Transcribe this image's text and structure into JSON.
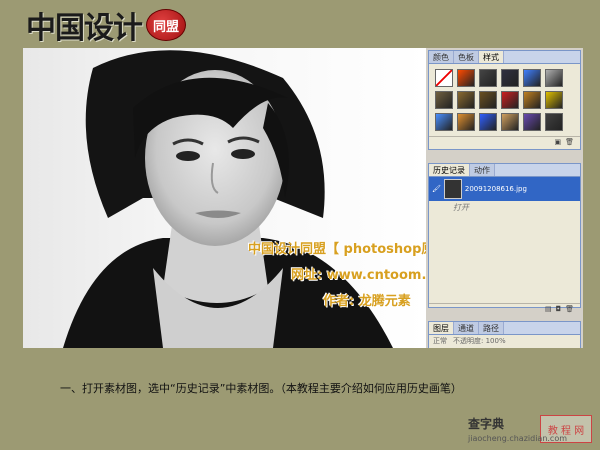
{
  "logo": {
    "text": "中国设计",
    "seal": "同盟"
  },
  "panels": {
    "swatches_tabs": [
      "颜色",
      "色板",
      "样式"
    ],
    "swatches_colors": [
      "#ffffff",
      "#ff4a00",
      "#444444",
      "#303040",
      "#4080ff",
      "#b0b0b0",
      "#706040",
      "#8a6a30",
      "#6a5020",
      "#cc2020",
      "#c08020",
      "#e0c000",
      "#4a90ff",
      "#e09030",
      "#3060ff",
      "#d0a060",
      "#6a4ab0",
      "#404040"
    ],
    "history_tabs": [
      "历史记录",
      "动作"
    ],
    "history_item": "20091208616.jpg",
    "history_step": "打开",
    "layers_tabs": [
      "图层",
      "通道",
      "路径"
    ],
    "layers_mode": "正常",
    "layers_opacity_label": "不透明度: 100%"
  },
  "watermark": {
    "line1": "中国设计同盟【 photoshop原创教程 】",
    "line2": "网址: www.cntoom.cn",
    "line3": "作者: 龙腾元素"
  },
  "caption": "一、打开素材图，选中“历史记录”中素材图。（本教程主要介绍如何应用历史画笔）",
  "site": {
    "name": "查字典",
    "badge": "教 程 网",
    "url": "jiaocheng.chazidian.com"
  }
}
